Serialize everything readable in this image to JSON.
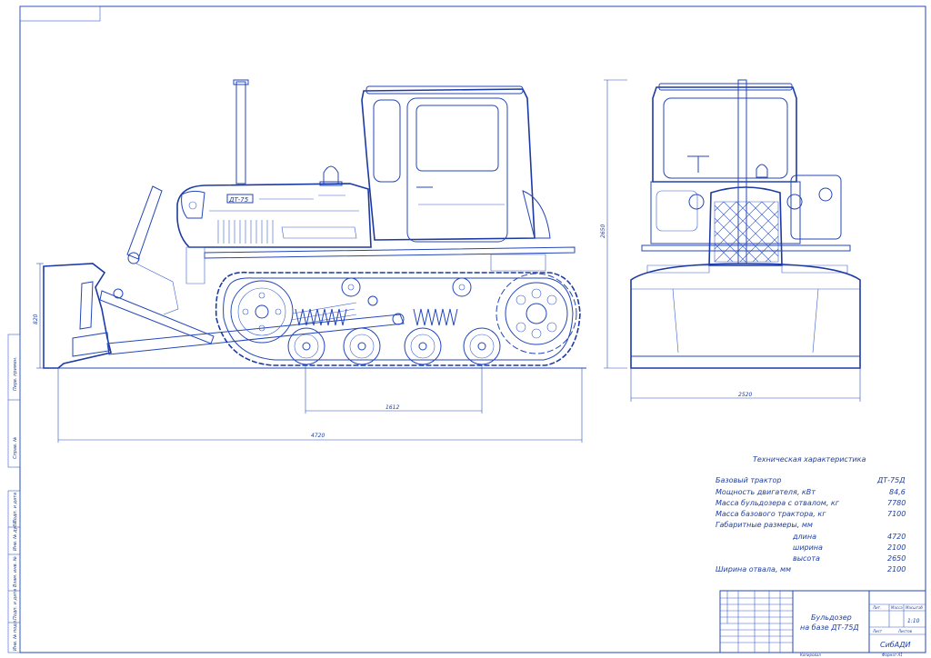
{
  "drawing": {
    "dimensions": {
      "wheelbase": "1612",
      "overall_length": "4720",
      "blade_height": "820",
      "height": "2650",
      "width": "2520"
    },
    "tech_specs": {
      "title": "Техническая характеристика",
      "rows": [
        {
          "label": "Базовый трактор",
          "value": "ДТ-75Д"
        },
        {
          "label": "Мощность двигателя, кВт",
          "value": "84,6"
        },
        {
          "label": "Масса бульдозера с отвалом, кг",
          "value": "7780"
        },
        {
          "label": "Масса базового трактора, кг",
          "value": "7100"
        },
        {
          "label": "Габаритные размеры, мм",
          "value": ""
        },
        {
          "label": "длина",
          "value": "4720"
        },
        {
          "label": "ширина",
          "value": "2100"
        },
        {
          "label": "высота",
          "value": "2650"
        },
        {
          "label": "Ширина отвала, мм",
          "value": "2100"
        }
      ]
    },
    "title_block": {
      "title_line1": "Бульдозер",
      "title_line2": "на базе ДТ-75Д",
      "organization": "СибАДИ",
      "scale": "1:10",
      "header_lit": "Лит.",
      "header_mass": "Масса",
      "header_scale": "Масштаб",
      "header_sheet": "Лист",
      "header_sheets": "Листов",
      "copied": "Копировал",
      "format": "Формат  А1"
    },
    "side_stamps": {
      "inv_orig": "Инв. № подл.",
      "sign_date": "Подп. и дата",
      "inv_dup": "Инв. № дубл.",
      "replace_inv": "Взам. инв. №",
      "sign_date2": "Подп. и дата",
      "ref_no": "Справ. №",
      "first_use": "Перв. примен."
    },
    "model_plate": "ДТ-75"
  }
}
